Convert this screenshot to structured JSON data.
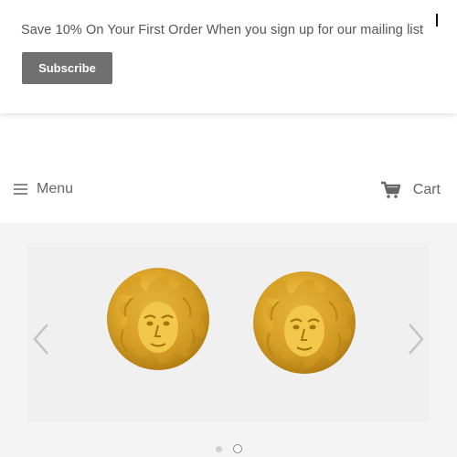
{
  "promo": {
    "text": "Save 10% On Your First Order When you sign up for our mailing list",
    "subscribe_label": "Subscribe",
    "close_icon": "close-icon"
  },
  "nav": {
    "menu_label": "Menu",
    "menu_icon": "hamburger-icon",
    "cart_label": "Cart",
    "cart_icon": "cart-icon"
  },
  "slider": {
    "image_subject": "gold medusa earrings",
    "prev_icon": "chevron-left-icon",
    "next_icon": "chevron-right-icon",
    "slide_count": 2,
    "active_slide": 2
  },
  "colors": {
    "subscribe_button": "#707070",
    "gold": "#d9a42a",
    "slider_bg": "#f4f4f4"
  }
}
